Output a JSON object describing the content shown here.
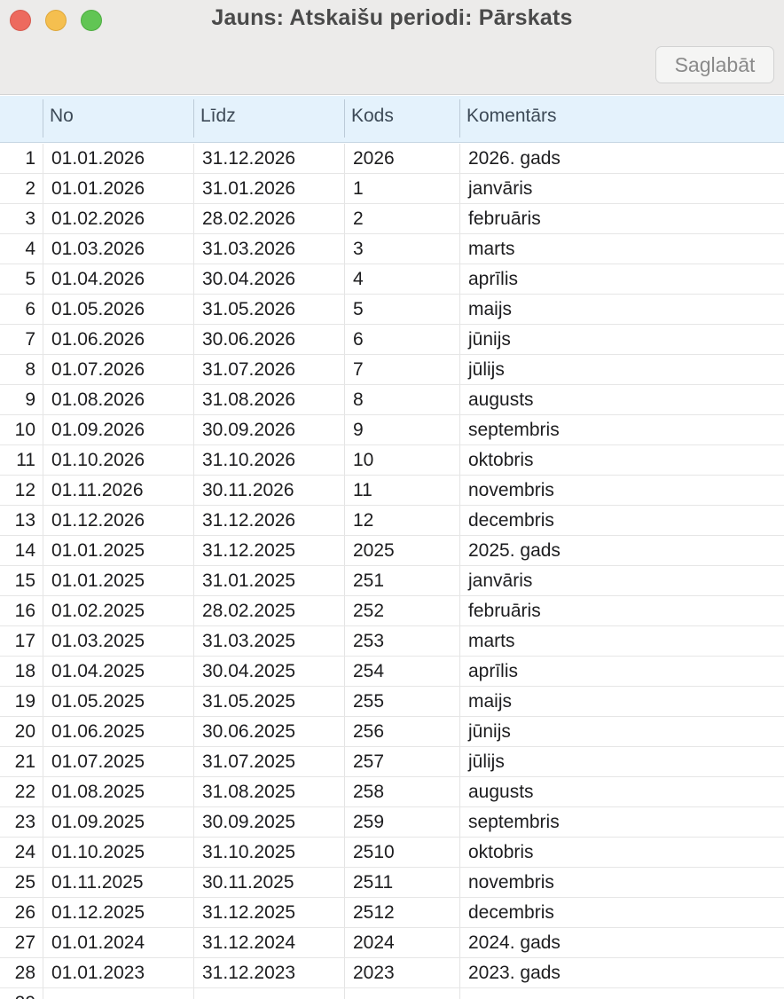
{
  "window": {
    "title": "Jauns: Atskaišu periodi: Pārskats",
    "save_label": "Saglabāt"
  },
  "table": {
    "columns": [
      "No",
      "Līdz",
      "Kods",
      "Komentārs"
    ],
    "rows": [
      {
        "n": "1",
        "no": "01.01.2026",
        "lidz": "31.12.2026",
        "kods": "2026",
        "komentars": "2026. gads"
      },
      {
        "n": "2",
        "no": "01.01.2026",
        "lidz": "31.01.2026",
        "kods": "1",
        "komentars": "janvāris"
      },
      {
        "n": "3",
        "no": "01.02.2026",
        "lidz": "28.02.2026",
        "kods": "2",
        "komentars": "februāris"
      },
      {
        "n": "4",
        "no": "01.03.2026",
        "lidz": "31.03.2026",
        "kods": "3",
        "komentars": "marts"
      },
      {
        "n": "5",
        "no": "01.04.2026",
        "lidz": "30.04.2026",
        "kods": "4",
        "komentars": "aprīlis"
      },
      {
        "n": "6",
        "no": "01.05.2026",
        "lidz": "31.05.2026",
        "kods": "5",
        "komentars": "maijs"
      },
      {
        "n": "7",
        "no": "01.06.2026",
        "lidz": "30.06.2026",
        "kods": "6",
        "komentars": "jūnijs"
      },
      {
        "n": "8",
        "no": "01.07.2026",
        "lidz": "31.07.2026",
        "kods": "7",
        "komentars": "jūlijs"
      },
      {
        "n": "9",
        "no": "01.08.2026",
        "lidz": "31.08.2026",
        "kods": "8",
        "komentars": "augusts"
      },
      {
        "n": "10",
        "no": "01.09.2026",
        "lidz": "30.09.2026",
        "kods": "9",
        "komentars": "septembris"
      },
      {
        "n": "11",
        "no": "01.10.2026",
        "lidz": "31.10.2026",
        "kods": "10",
        "komentars": "oktobris"
      },
      {
        "n": "12",
        "no": "01.11.2026",
        "lidz": "30.11.2026",
        "kods": "11",
        "komentars": "novembris"
      },
      {
        "n": "13",
        "no": "01.12.2026",
        "lidz": "31.12.2026",
        "kods": "12",
        "komentars": "decembris"
      },
      {
        "n": "14",
        "no": "01.01.2025",
        "lidz": "31.12.2025",
        "kods": "2025",
        "komentars": "2025. gads"
      },
      {
        "n": "15",
        "no": "01.01.2025",
        "lidz": "31.01.2025",
        "kods": "251",
        "komentars": "janvāris"
      },
      {
        "n": "16",
        "no": "01.02.2025",
        "lidz": "28.02.2025",
        "kods": "252",
        "komentars": "februāris"
      },
      {
        "n": "17",
        "no": "01.03.2025",
        "lidz": "31.03.2025",
        "kods": "253",
        "komentars": "marts"
      },
      {
        "n": "18",
        "no": "01.04.2025",
        "lidz": "30.04.2025",
        "kods": "254",
        "komentars": "aprīlis"
      },
      {
        "n": "19",
        "no": "01.05.2025",
        "lidz": "31.05.2025",
        "kods": "255",
        "komentars": "maijs"
      },
      {
        "n": "20",
        "no": "01.06.2025",
        "lidz": "30.06.2025",
        "kods": "256",
        "komentars": "jūnijs"
      },
      {
        "n": "21",
        "no": "01.07.2025",
        "lidz": "31.07.2025",
        "kods": "257",
        "komentars": "jūlijs"
      },
      {
        "n": "22",
        "no": "01.08.2025",
        "lidz": "31.08.2025",
        "kods": "258",
        "komentars": "augusts"
      },
      {
        "n": "23",
        "no": "01.09.2025",
        "lidz": "30.09.2025",
        "kods": "259",
        "komentars": "septembris"
      },
      {
        "n": "24",
        "no": "01.10.2025",
        "lidz": "31.10.2025",
        "kods": "2510",
        "komentars": "oktobris"
      },
      {
        "n": "25",
        "no": "01.11.2025",
        "lidz": "30.11.2025",
        "kods": "2511",
        "komentars": "novembris"
      },
      {
        "n": "26",
        "no": "01.12.2025",
        "lidz": "31.12.2025",
        "kods": "2512",
        "komentars": "decembris"
      },
      {
        "n": "27",
        "no": "01.01.2024",
        "lidz": "31.12.2024",
        "kods": "2024",
        "komentars": "2024. gads"
      },
      {
        "n": "28",
        "no": "01.01.2023",
        "lidz": "31.12.2023",
        "kods": "2023",
        "komentars": "2023. gads"
      },
      {
        "n": "29",
        "no": "",
        "lidz": "",
        "kods": "",
        "komentars": ""
      }
    ]
  }
}
